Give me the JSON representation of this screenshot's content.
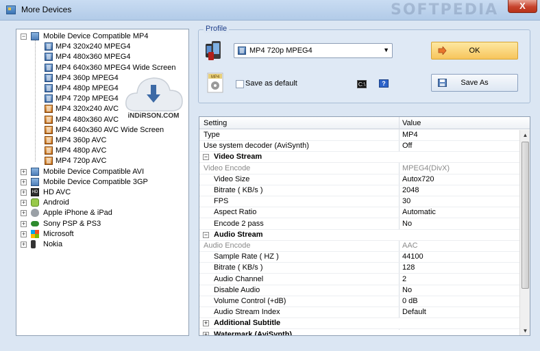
{
  "window": {
    "title": "More Devices",
    "watermark": "SOFTPEDIA",
    "close_label": "X"
  },
  "tree": {
    "groups": [
      {
        "label": "Mobile Device Compatible MP4",
        "expanded": true,
        "icon": "folder-icon",
        "children": [
          {
            "label": "MP4 320x240 MPEG4",
            "icon": "blue"
          },
          {
            "label": "MP4 480x360 MPEG4",
            "icon": "blue"
          },
          {
            "label": "MP4 640x360 MPEG4 Wide Screen",
            "icon": "blue"
          },
          {
            "label": "MP4 360p MPEG4",
            "icon": "blue"
          },
          {
            "label": "MP4 480p MPEG4",
            "icon": "blue"
          },
          {
            "label": "MP4 720p MPEG4",
            "icon": "blue"
          },
          {
            "label": "MP4 320x240 AVC",
            "icon": "orange"
          },
          {
            "label": "MP4 480x360 AVC",
            "icon": "orange"
          },
          {
            "label": "MP4 640x360 AVC Wide Screen",
            "icon": "orange"
          },
          {
            "label": "MP4 360p AVC",
            "icon": "orange"
          },
          {
            "label": "MP4 480p AVC",
            "icon": "orange"
          },
          {
            "label": "MP4 720p AVC",
            "icon": "orange"
          }
        ]
      },
      {
        "label": "Mobile Device Compatible AVI",
        "icon": "folder"
      },
      {
        "label": "Mobile Device Compatible 3GP",
        "icon": "folder"
      },
      {
        "label": "HD AVC",
        "icon": "hd"
      },
      {
        "label": "Android",
        "icon": "android"
      },
      {
        "label": "Apple iPhone & iPad",
        "icon": "apple"
      },
      {
        "label": "Sony PSP & PS3",
        "icon": "psp"
      },
      {
        "label": "Microsoft",
        "icon": "ms"
      },
      {
        "label": "Nokia",
        "icon": "nokia"
      }
    ]
  },
  "watermark_logo": "iNDiRSON.COM",
  "profile": {
    "legend": "Profile",
    "selected": "MP4 720p MPEG4",
    "save_default_label": "Save as default",
    "save_default_checked": false,
    "ok_label": "OK",
    "save_as_label": "Save As",
    "cmd_label": "C:\\",
    "help_label": "?"
  },
  "grid": {
    "headers": {
      "setting": "Setting",
      "value": "Value"
    },
    "rows": [
      {
        "k": "Type",
        "v": "MP4",
        "kind": "plain"
      },
      {
        "k": "Use system decoder (AviSynth)",
        "v": "Off",
        "kind": "plain"
      },
      {
        "k": "Video Stream",
        "v": "",
        "kind": "section",
        "exp": "−"
      },
      {
        "k": "Video Encode",
        "v": "MPEG4(DivX)",
        "kind": "dim"
      },
      {
        "k": "Video Size",
        "v": "Autox720",
        "kind": "sub"
      },
      {
        "k": "Bitrate ( KB/s )",
        "v": "2048",
        "kind": "sub"
      },
      {
        "k": "FPS",
        "v": "30",
        "kind": "sub"
      },
      {
        "k": "Aspect Ratio",
        "v": "Automatic",
        "kind": "sub"
      },
      {
        "k": "Encode 2 pass",
        "v": "No",
        "kind": "sub"
      },
      {
        "k": "Audio Stream",
        "v": "",
        "kind": "section",
        "exp": "−"
      },
      {
        "k": "Audio Encode",
        "v": "AAC",
        "kind": "dim"
      },
      {
        "k": "Sample Rate ( HZ )",
        "v": "44100",
        "kind": "sub"
      },
      {
        "k": "Bitrate ( KB/s )",
        "v": "128",
        "kind": "sub"
      },
      {
        "k": "Audio Channel",
        "v": "2",
        "kind": "sub"
      },
      {
        "k": "Disable Audio",
        "v": "No",
        "kind": "sub"
      },
      {
        "k": "Volume Control (+dB)",
        "v": "0 dB",
        "kind": "sub"
      },
      {
        "k": "Audio Stream Index",
        "v": "Default",
        "kind": "sub"
      },
      {
        "k": "Additional Subtitle",
        "v": "",
        "kind": "section",
        "exp": "+"
      },
      {
        "k": "Watermark (AviSynth)",
        "v": "",
        "kind": "section",
        "exp": "+"
      }
    ]
  },
  "colors": {
    "ok_bg": "#f7c55c",
    "window_bg": "#dbe6f3",
    "section_header": "#000000"
  }
}
